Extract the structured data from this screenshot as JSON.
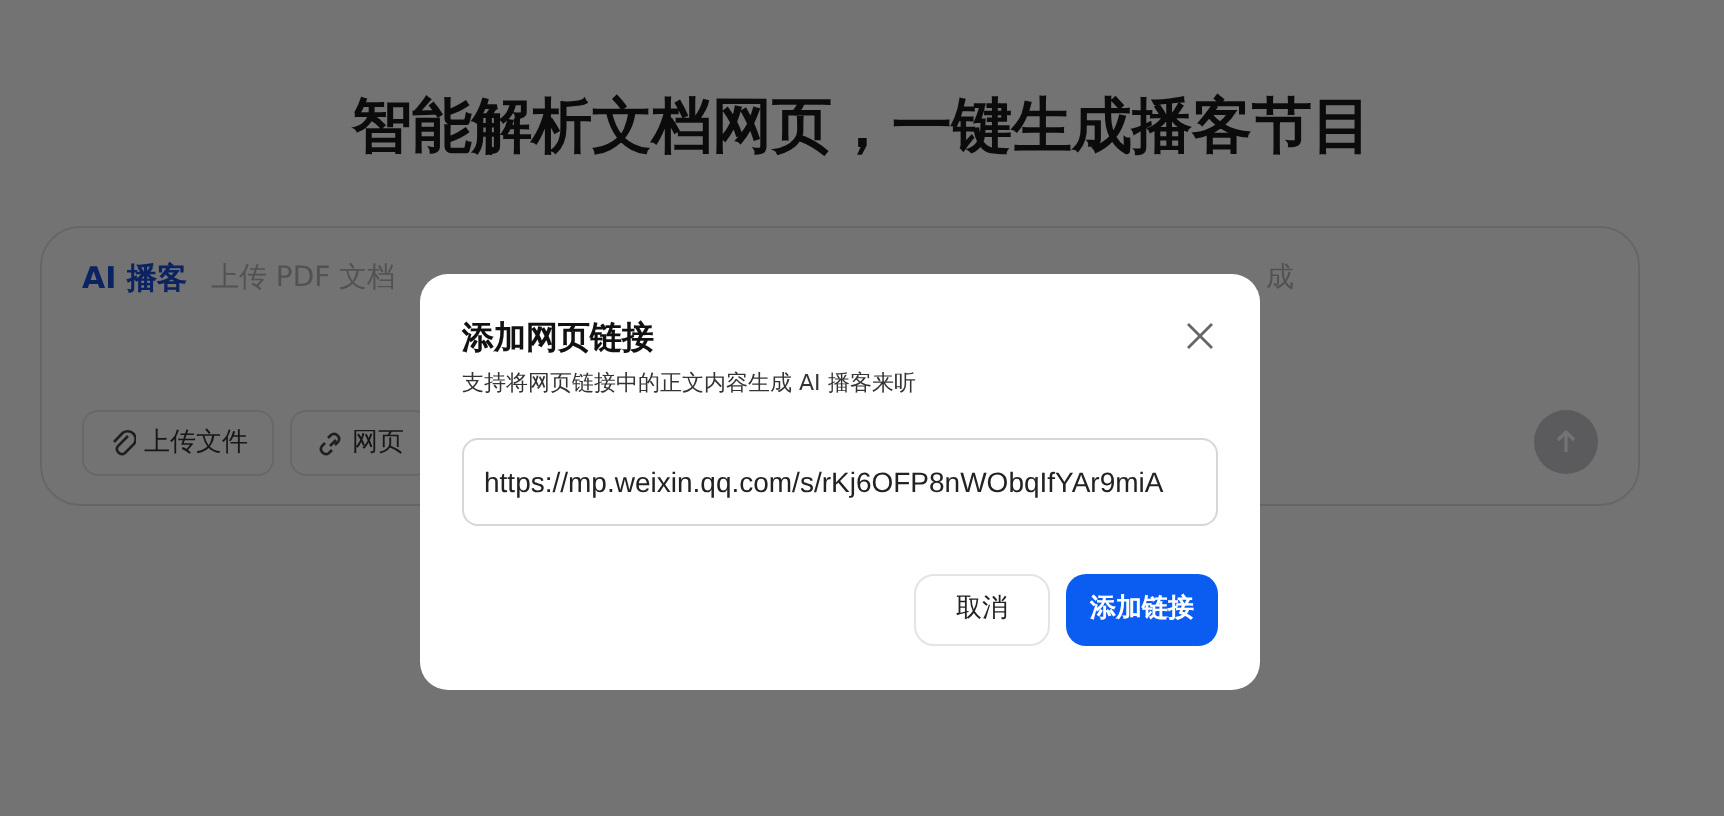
{
  "heading": "智能解析文档网页，一键生成播客节目",
  "composer": {
    "brand": "AI 播客",
    "placeholder_visible": "上传 PDF 文档",
    "placeholder_tail": "成",
    "tools": [
      {
        "kind": "file",
        "label": "上传文件"
      },
      {
        "kind": "link",
        "label": "网页"
      }
    ]
  },
  "dialog": {
    "title": "添加网页链接",
    "subtitle": "支持将网页链接中的正文内容生成 AI 播客来听",
    "url_value": "https://mp.weixin.qq.com/s/rKj6OFP8nWObqIfYAr9miA",
    "buttons": [
      {
        "label": "取消",
        "primary": false
      },
      {
        "label": "添加链接",
        "primary": true
      }
    ]
  }
}
